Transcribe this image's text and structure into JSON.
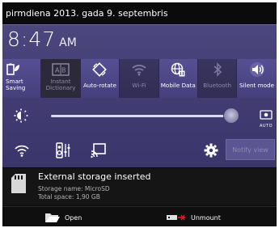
{
  "status_bar": {
    "date_text": "pirmdiena 2013. gada 9. septembris"
  },
  "clock": {
    "time": "8:47",
    "ampm": "AM"
  },
  "toggles": [
    {
      "label_line1": "Smart",
      "label_line2": "Saving",
      "state": "on",
      "icon": "smart-saving-icon"
    },
    {
      "label_line1": "Instant",
      "label_line2": "Dictionary",
      "state": "off",
      "icon": "dictionary-icon"
    },
    {
      "label_line1": "Auto-rotate",
      "label_line2": "",
      "state": "on",
      "icon": "auto-rotate-icon"
    },
    {
      "label_line1": "Wi-Fi",
      "label_line2": "",
      "state": "off",
      "icon": "wifi-icon"
    },
    {
      "label_line1": "Mobile Data",
      "label_line2": "",
      "state": "on",
      "icon": "globe-icon"
    },
    {
      "label_line1": "Bluetooth",
      "label_line2": "",
      "state": "off",
      "icon": "bluetooth-icon"
    },
    {
      "label_line1": "Silent mode",
      "label_line2": "",
      "state": "on",
      "icon": "speaker-icon"
    }
  ],
  "brightness": {
    "level": 0.98,
    "auto_label": "AUTO"
  },
  "quick_row": {
    "notify_label": "Notify view"
  },
  "notification": {
    "title": "External storage inserted",
    "line1": "Storage name: MicroSD",
    "line2": "Total space: 1,90 GB"
  },
  "actions": {
    "open_label": "Open",
    "unmount_label": "Unmount"
  },
  "colors": {
    "panel": "#453f77",
    "accent": "#564f93",
    "notif_bg": "#151515"
  }
}
